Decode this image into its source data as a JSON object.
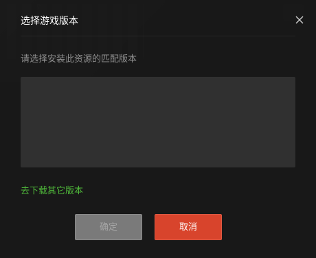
{
  "dialog": {
    "title": "选择游戏版本",
    "subtitle": "请选择安装此资源的匹配版本",
    "download_other_link": "去下载其它版本",
    "confirm_label": "确定",
    "cancel_label": "取消",
    "close_icon": "close-icon"
  },
  "colors": {
    "accent": "#d8442c",
    "link": "#4fb83a",
    "list_bg": "#303030",
    "disabled_button": "#7a7a7a"
  }
}
